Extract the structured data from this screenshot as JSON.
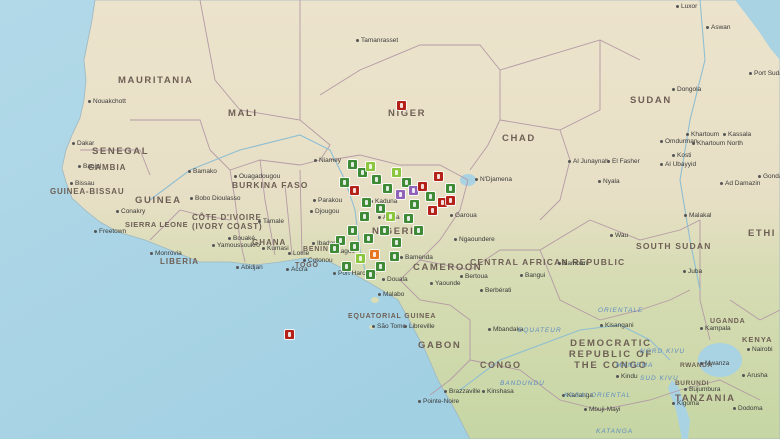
{
  "map": {
    "countries": [
      {
        "id": "mauritania",
        "name": "MAURITANIA"
      },
      {
        "id": "mali",
        "name": "MALI"
      },
      {
        "id": "niger",
        "name": "NIGER"
      },
      {
        "id": "chad",
        "name": "CHAD"
      },
      {
        "id": "sudan",
        "name": "SUDAN"
      },
      {
        "id": "senegal",
        "name": "SENEGAL"
      },
      {
        "id": "gambia",
        "name": "GAMBIA"
      },
      {
        "id": "guinea-bissau",
        "name": "GUINEA-BISSAU"
      },
      {
        "id": "guinea",
        "name": "GUINEA"
      },
      {
        "id": "sierra-leone",
        "name": "SIERRA LEONE"
      },
      {
        "id": "liberia",
        "name": "LIBERIA"
      },
      {
        "id": "cote-divoire",
        "name": "CÔTE D'IVOIRE (IVORY COAST)"
      },
      {
        "id": "burkina-faso",
        "name": "BURKINA FASO"
      },
      {
        "id": "ghana",
        "name": "GHANA"
      },
      {
        "id": "benin",
        "name": "BENIN"
      },
      {
        "id": "togo",
        "name": "TOGO"
      },
      {
        "id": "nigeria",
        "name": "NIGERIA"
      },
      {
        "id": "cameroon",
        "name": "CAMEROON"
      },
      {
        "id": "car",
        "name": "CENTRAL AFRICAN REPUBLIC"
      },
      {
        "id": "south-sudan",
        "name": "SOUTH SUDAN"
      },
      {
        "id": "ethiopia",
        "name": "ETHI"
      },
      {
        "id": "equatorial-guinea",
        "name": "EQUATORIAL GUINEA"
      },
      {
        "id": "gabon",
        "name": "GABON"
      },
      {
        "id": "congo",
        "name": "CONGO"
      },
      {
        "id": "drc",
        "name": "DEMOCRATIC REPUBLIC OF THE CONGO"
      },
      {
        "id": "tanzania",
        "name": "TANZANIA"
      },
      {
        "id": "rwanda",
        "name": "RWANDA"
      },
      {
        "id": "burundi",
        "name": "BURUNDI"
      },
      {
        "id": "uganda",
        "name": "UGANDA"
      },
      {
        "id": "kenya",
        "name": "KENYA"
      }
    ],
    "cities": [
      {
        "id": "tamanrasset",
        "name": "Tamanrasset"
      },
      {
        "id": "luxor",
        "name": "Luxor"
      },
      {
        "id": "aswan",
        "name": "Aswan"
      },
      {
        "id": "dongola",
        "name": "Dongola"
      },
      {
        "id": "port-sudan",
        "name": "Port Sudan"
      },
      {
        "id": "nouakchott",
        "name": "Nouakchott"
      },
      {
        "id": "dakar",
        "name": "Dakar"
      },
      {
        "id": "banjul",
        "name": "Banjul"
      },
      {
        "id": "bissau",
        "name": "Bissau"
      },
      {
        "id": "conakry",
        "name": "Conakry"
      },
      {
        "id": "freetown",
        "name": "Freetown"
      },
      {
        "id": "monrovia",
        "name": "Monrovia"
      },
      {
        "id": "bamako",
        "name": "Bamako"
      },
      {
        "id": "bobo",
        "name": "Bobo Dioulasso"
      },
      {
        "id": "ouagadougou",
        "name": "Ouagadougou"
      },
      {
        "id": "niamey",
        "name": "Niamey"
      },
      {
        "id": "tamale",
        "name": "Tamale"
      },
      {
        "id": "bouake",
        "name": "Bouaké"
      },
      {
        "id": "yamoussoukro",
        "name": "Yamoussoukro"
      },
      {
        "id": "abidjan",
        "name": "Abidjan"
      },
      {
        "id": "kumasi",
        "name": "Kumasi"
      },
      {
        "id": "accra",
        "name": "Accra"
      },
      {
        "id": "lome",
        "name": "Lome"
      },
      {
        "id": "cotonou",
        "name": "Cotonou"
      },
      {
        "id": "djougou",
        "name": "Djougou"
      },
      {
        "id": "parakou",
        "name": "Parakou"
      },
      {
        "id": "ibadan",
        "name": "Ibadan"
      },
      {
        "id": "lagos",
        "name": "Lagos"
      },
      {
        "id": "abuja",
        "name": "Abuja"
      },
      {
        "id": "kaduna",
        "name": "Kaduna"
      },
      {
        "id": "port-harcourt",
        "name": "Port Harcourt"
      },
      {
        "id": "garoua",
        "name": "Garoua"
      },
      {
        "id": "ngaoundere",
        "name": "Ngaoundere"
      },
      {
        "id": "ndjamena",
        "name": "N'Djamena"
      },
      {
        "id": "bamenda",
        "name": "Bamenda"
      },
      {
        "id": "douala",
        "name": "Douala"
      },
      {
        "id": "yaounde",
        "name": "Yaounde"
      },
      {
        "id": "bertoua",
        "name": "Bertoua"
      },
      {
        "id": "malabo",
        "name": "Malabo"
      },
      {
        "id": "sao-tome",
        "name": "São Tome"
      },
      {
        "id": "libreville",
        "name": "Libreville"
      },
      {
        "id": "bangui",
        "name": "Bangui"
      },
      {
        "id": "berbérati",
        "name": "Berbérati"
      },
      {
        "id": "bambari",
        "name": "Bambari"
      },
      {
        "id": "al-junaynah",
        "name": "Al Junaynah"
      },
      {
        "id": "el-fasher",
        "name": "El Fasher"
      },
      {
        "id": "nyala",
        "name": "Nyala"
      },
      {
        "id": "khartoum",
        "name": "Khartoum"
      },
      {
        "id": "omdurman",
        "name": "Omdurman"
      },
      {
        "id": "khartoum-north",
        "name": "Khartoum North"
      },
      {
        "id": "kassala",
        "name": "Kassala"
      },
      {
        "id": "al-ubayyid",
        "name": "Al Ubayyid"
      },
      {
        "id": "kosti",
        "name": "Kosti"
      },
      {
        "id": "ad-damazin",
        "name": "Ad Damazin"
      },
      {
        "id": "malakal",
        "name": "Malakal"
      },
      {
        "id": "wau",
        "name": "Wau"
      },
      {
        "id": "juba",
        "name": "Juba"
      },
      {
        "id": "mbandaka",
        "name": "Mbandaka"
      },
      {
        "id": "kisangani",
        "name": "Kisangani"
      },
      {
        "id": "kampala",
        "name": "Kampala"
      },
      {
        "id": "nairobi",
        "name": "Nairobi"
      },
      {
        "id": "mwanza",
        "name": "Mwanza"
      },
      {
        "id": "arusha",
        "name": "Arusha"
      },
      {
        "id": "dodoma",
        "name": "Dodoma"
      },
      {
        "id": "kigoma",
        "name": "Kigoma"
      },
      {
        "id": "bujumbura",
        "name": "Bujumbura"
      },
      {
        "id": "kindu",
        "name": "Kindu"
      },
      {
        "id": "kananga",
        "name": "Kananga"
      },
      {
        "id": "mbuji-mayi",
        "name": "Mbuji-Mayi"
      },
      {
        "id": "kinshasa",
        "name": "Kinshasa"
      },
      {
        "id": "brazzaville",
        "name": "Brazzaville"
      },
      {
        "id": "pointe-noire",
        "name": "Pointe-Noire"
      },
      {
        "id": "gondar",
        "name": "Gondar"
      }
    ],
    "waters": [
      {
        "id": "equateur",
        "name": "EQUATEUR"
      },
      {
        "id": "orientale",
        "name": "ORIENTALE"
      },
      {
        "id": "nord-kivu",
        "name": "NORD KIVU"
      },
      {
        "id": "sud-kivu",
        "name": "SUD KIVU"
      },
      {
        "id": "maniema",
        "name": "MANIEMA"
      },
      {
        "id": "bandundu",
        "name": "BANDUNDU"
      },
      {
        "id": "kasai",
        "name": "KASAI ORIENTAL"
      },
      {
        "id": "katanga",
        "name": "KATANGA"
      }
    ],
    "markers": [
      {
        "id": "m-niger-1",
        "status": "red"
      },
      {
        "id": "m-ocean-1",
        "status": "red"
      },
      {
        "id": "m-nig-1",
        "status": "green"
      },
      {
        "id": "m-nig-2",
        "status": "green"
      },
      {
        "id": "m-nig-3",
        "status": "green"
      },
      {
        "id": "m-nig-4",
        "status": "light-green"
      },
      {
        "id": "m-nig-5",
        "status": "green"
      },
      {
        "id": "m-nig-6",
        "status": "red"
      },
      {
        "id": "m-nig-7",
        "status": "green"
      },
      {
        "id": "m-nig-8",
        "status": "light-green"
      },
      {
        "id": "m-nig-9",
        "status": "green"
      },
      {
        "id": "m-nig-10",
        "status": "purple"
      },
      {
        "id": "m-nig-11",
        "status": "red"
      },
      {
        "id": "m-nig-12",
        "status": "green"
      },
      {
        "id": "m-nig-13",
        "status": "red"
      },
      {
        "id": "m-nig-14",
        "status": "green"
      },
      {
        "id": "m-nig-15",
        "status": "red"
      },
      {
        "id": "m-nig-16",
        "status": "green"
      },
      {
        "id": "m-nig-17",
        "status": "purple"
      },
      {
        "id": "m-nig-18",
        "status": "red"
      },
      {
        "id": "m-nig-19",
        "status": "green"
      },
      {
        "id": "m-nig-20",
        "status": "green"
      },
      {
        "id": "m-nig-21",
        "status": "green"
      },
      {
        "id": "m-nig-22",
        "status": "light-green"
      },
      {
        "id": "m-nig-23",
        "status": "green"
      },
      {
        "id": "m-nig-24",
        "status": "green"
      },
      {
        "id": "m-nig-25",
        "status": "green"
      },
      {
        "id": "m-nig-26",
        "status": "green"
      },
      {
        "id": "m-nig-27",
        "status": "orange"
      },
      {
        "id": "m-nig-28",
        "status": "green"
      },
      {
        "id": "m-nig-29",
        "status": "green"
      },
      {
        "id": "m-nig-30",
        "status": "light-green"
      },
      {
        "id": "m-nig-31",
        "status": "green"
      },
      {
        "id": "m-nig-32",
        "status": "green"
      },
      {
        "id": "m-nig-33",
        "status": "green"
      },
      {
        "id": "m-nig-34",
        "status": "green"
      },
      {
        "id": "m-nig-35",
        "status": "green"
      },
      {
        "id": "m-nig-36",
        "status": "red"
      },
      {
        "id": "m-nig-37",
        "status": "green"
      },
      {
        "id": "m-nig-38",
        "status": "green"
      }
    ],
    "colors": {
      "ocean": "#a9d3e3",
      "desert": "#eae0c8",
      "savanna": "#e3e1c3",
      "forest": "#c9d8a8",
      "border": "#b49aa5",
      "marker_green": "#3f8a37",
      "marker_light_green": "#8cc63f",
      "marker_red": "#b32118",
      "marker_orange": "#e87722",
      "marker_purple": "#9062b8"
    }
  }
}
